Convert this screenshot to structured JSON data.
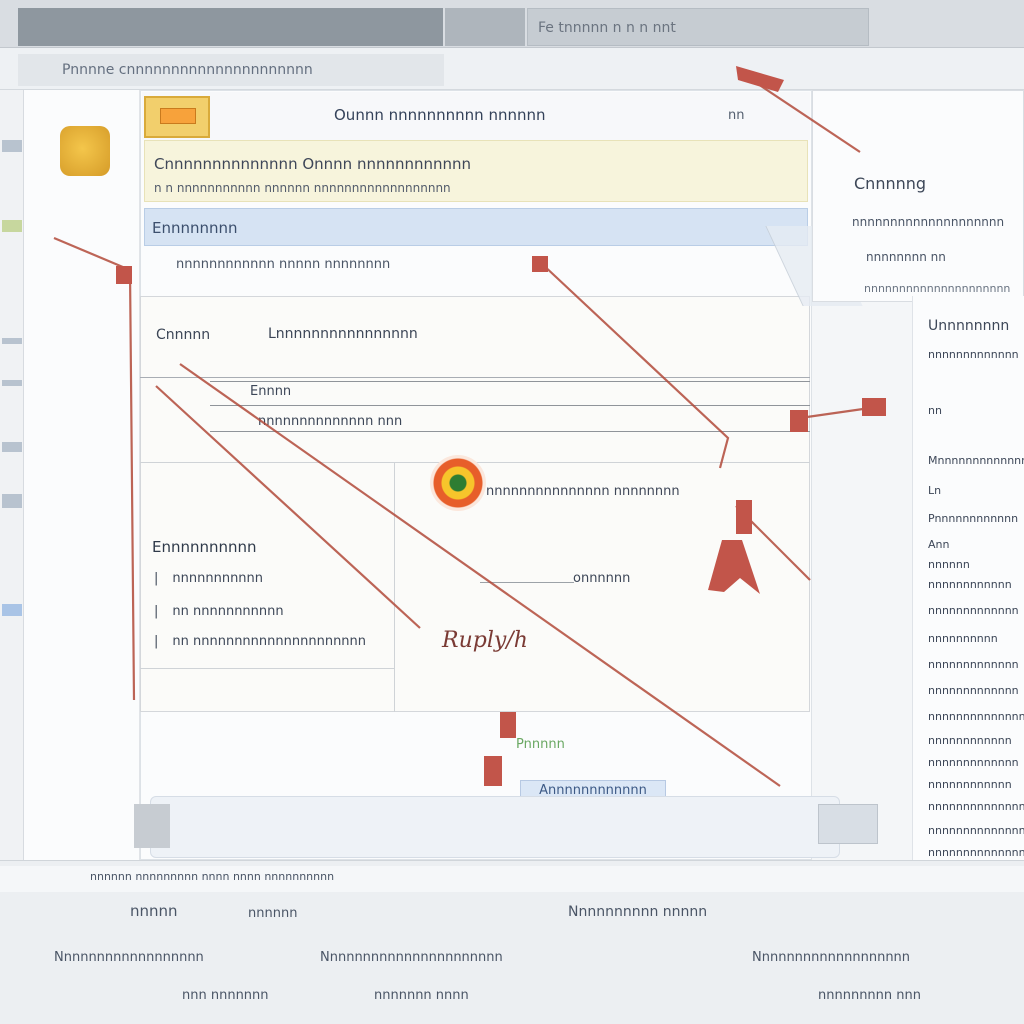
{
  "window": {
    "title": "Fe tnnnnn n n n nnt",
    "breadcrumb": "Pnnnne cnnnnnnnnnnnnnnnnnnnnn"
  },
  "document": {
    "heading": "Ounnn nnnnnnnnnn nnnnnn",
    "close": "nn",
    "notice_line1": "Cnnnnnnnnnnnnnn Onnnn nnnnnnnnnnnn",
    "notice_line2": "n n nnnnnnnnnnn nnnnnn nnnnnnnnnnnnnnnnnn",
    "section_title": "Ennnnnnnn",
    "subnav": "nnnnnnnnnnnn nnnnn nnnnnnnn",
    "form": {
      "label_a": "Cnnnnn",
      "value_a": "Lnnnnnnnnnnnnnnnn",
      "code": "Ennnn",
      "ref": "nnnnnnnnnnnnnn nnn",
      "status_text": "nnnnnnnnnnnnnnn nnnnnnnn",
      "list_heading": "Ennnnnnnnnn",
      "list_items": [
        "nnnnnnnnnnn",
        "nn nnnnnnnnnnn",
        "nn nnnnnnnnnnnnnnnnnnnnn"
      ],
      "amount": "onnnnnn",
      "signature": "Ruply/h"
    },
    "approved": "Pnnnnn",
    "approve_button": "Annnnnnnnnnnn"
  },
  "popup": {
    "title": "Cnnnnng",
    "sub": "nnnnnnnnnnnnnnnnnnnn",
    "line2": "nnnnnnnn nn",
    "line3": "nnnnnnnnnnnnnnnnnnnnn"
  },
  "right_panel": {
    "items": [
      "Unnnnnnnn",
      "nnnnnnnnnnnnn",
      "nn",
      "Mnnnnnnnnnnnnn",
      "Ln",
      "Pnnnnnnnnnnnn",
      "Ann",
      "nnnnnn",
      "nnnnnnnnnnnn",
      "nnnnnnnnnnnnn",
      "nnnnnnnnnn",
      "nnnnnnnnnnnnn",
      "nnnnnnnnnnnnn",
      "nnnnnnnnnnnnnn",
      "nnnnnnnnnnnn",
      "nnnnnnnnnnnnn",
      "nnnnnnnnnnnn",
      "nnnnnnnnnnnnnn",
      "nnnnnnnnnnnnnn",
      "nnnnnnnnnnnnnn"
    ]
  },
  "status_bar": {
    "row0": "nnnnnn nnnnnnnnn nnnn nnnn nnnnnnnnnn",
    "row1": [
      "nnnnn",
      "nnnnnn",
      "Nnnnnnnnnn nnnnn"
    ],
    "row2": [
      "Nnnnnnnnnnnnnnnnnn",
      "Nnnnnnnnnnnnnnnnnnnnnn",
      "Nnnnnnnnnnnnnnnnnnn"
    ],
    "row3": [
      "nnn nnnnnnn",
      "nnnnnnn nnnn",
      "nnnnnnnnn nnn"
    ]
  },
  "colors": {
    "notice_bg": "#f7f4dc",
    "section_bg": "#d6e3f3",
    "annotation": "#b24a3a"
  }
}
